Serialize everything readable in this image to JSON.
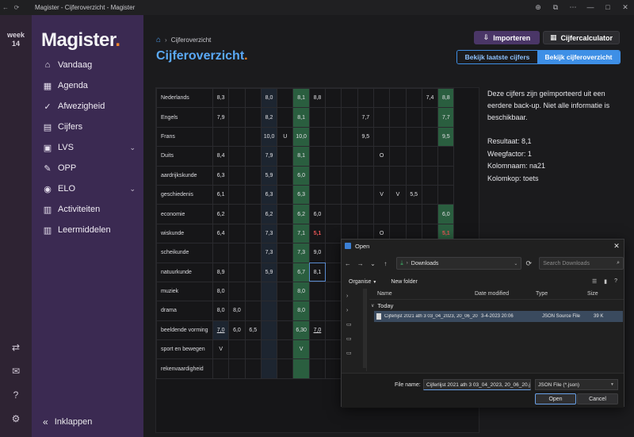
{
  "titlebar": {
    "title": "Magister - Cijferoverzicht - Magister",
    "back": "←",
    "reload": "⟳",
    "icons": [
      "⊕",
      "⧉",
      "⋯",
      "—",
      "□",
      "✕"
    ]
  },
  "weekbar": {
    "label": "week",
    "number": "14",
    "bottom_icons": [
      "⇄",
      "✉",
      "?",
      "⚙"
    ]
  },
  "sidebar": {
    "logo": "Magister",
    "logo_dot": ".",
    "items": [
      {
        "label": "Vandaag",
        "icon": "⌂"
      },
      {
        "label": "Agenda",
        "icon": "▦"
      },
      {
        "label": "Afwezigheid",
        "icon": "✓"
      },
      {
        "label": "Cijfers",
        "icon": "▤"
      },
      {
        "label": "LVS",
        "icon": "▣",
        "chevron": "⌄"
      },
      {
        "label": "OPP",
        "icon": "✎"
      },
      {
        "label": "ELO",
        "icon": "◉",
        "chevron": "⌄"
      },
      {
        "label": "Activiteiten",
        "icon": "▥"
      },
      {
        "label": "Leermiddelen",
        "icon": "▥"
      }
    ],
    "collapse": {
      "label": "Inklappen",
      "icon": "«"
    }
  },
  "header": {
    "breadcrumb": "Cijferoverzicht",
    "title": "Cijferoverzicht",
    "title_dot": ".",
    "import_button": "Importeren",
    "calc_button": "Cijfercalculator",
    "seg_latest": "Bekijk laatste cijfers",
    "seg_overview": "Bekijk cijferoverzicht"
  },
  "grades": {
    "rows": [
      {
        "subject": "Nederlands",
        "cells": [
          "8,3",
          "",
          "",
          "8,0",
          "",
          "8,1",
          "8,8",
          "",
          "",
          "",
          "",
          "",
          "",
          "7,4",
          "8,8"
        ]
      },
      {
        "subject": "Engels",
        "cells": [
          "7,9",
          "",
          "",
          "8,2",
          "",
          "8,1",
          "",
          "",
          "",
          "7,7",
          "",
          "",
          "",
          "",
          "7,7"
        ]
      },
      {
        "subject": "Frans",
        "cells": [
          "",
          "",
          "",
          "10,0",
          "U",
          "10,0",
          "",
          "",
          "",
          "9,5",
          "",
          "",
          "",
          "",
          "9,5"
        ]
      },
      {
        "subject": "Duits",
        "cells": [
          "8,4",
          "",
          "",
          "7,9",
          "",
          "8,1",
          "",
          "",
          "",
          "",
          "O",
          "",
          "",
          "",
          ""
        ]
      },
      {
        "subject": "aardrijkskunde",
        "cells": [
          "6,3",
          "",
          "",
          "5,9",
          "",
          "6,0",
          "",
          "",
          "",
          "",
          "",
          "",
          "",
          "",
          ""
        ]
      },
      {
        "subject": "geschiedenis",
        "cells": [
          "6,1",
          "",
          "",
          "6,3",
          "",
          "6,3",
          "",
          "",
          "",
          "",
          "V",
          "V",
          "5,5",
          "",
          ""
        ]
      },
      {
        "subject": "economie",
        "cells": [
          "6,2",
          "",
          "",
          "6,2",
          "",
          "6,2",
          "6,0",
          "",
          "",
          "",
          "",
          "",
          "",
          "",
          "6,0"
        ]
      },
      {
        "subject": "wiskunde",
        "cells": [
          "6,4",
          "",
          "",
          "7,3",
          "",
          "7,1",
          "5,1",
          "",
          "",
          "",
          "O",
          "",
          "",
          "",
          "5,1"
        ]
      },
      {
        "subject": "scheikunde",
        "cells": [
          "",
          "",
          "",
          "7,3",
          "",
          "7,3",
          "9,0",
          "",
          "",
          "",
          "",
          "",
          "",
          "",
          ""
        ]
      },
      {
        "subject": "natuurkunde",
        "cells": [
          "8,9",
          "",
          "",
          "5,9",
          "",
          "6,7",
          "8,1",
          "",
          "",
          "",
          "",
          "",
          "",
          "",
          ""
        ]
      },
      {
        "subject": "muziek",
        "cells": [
          "8,0",
          "",
          "",
          "",
          "",
          "8,0",
          "",
          "",
          "",
          "",
          "",
          "",
          "",
          "",
          ""
        ]
      },
      {
        "subject": "drama",
        "cells": [
          "8,0",
          "8,0",
          "",
          "",
          "",
          "8,0",
          "",
          "",
          "",
          "",
          "",
          "",
          "",
          "",
          ""
        ]
      },
      {
        "subject": "beeldende vorming",
        "cells": [
          "7,0",
          "6,0",
          "6,5",
          "",
          "",
          "6,30",
          "7,0",
          "",
          "",
          "",
          "",
          "",
          "",
          "",
          ""
        ]
      },
      {
        "subject": "sport en bewegen",
        "cells": [
          "V",
          "",
          "",
          "",
          "",
          "V",
          "",
          "",
          "",
          "",
          "",
          "",
          "",
          "",
          ""
        ]
      },
      {
        "subject": "rekenvaardigheid",
        "cells": [
          "",
          "",
          "",
          "",
          "",
          "",
          "",
          "",
          "",
          "",
          "",
          "",
          "",
          "",
          ""
        ]
      }
    ]
  },
  "info": {
    "message": "Deze cijfers zijn geïmporteerd uit een eerdere back-up. Niet alle informatie is beschikbaar.",
    "resultaat": "Resultaat: 8,1",
    "weegfactor": "Weegfactor: 1",
    "kolomnaam": "Kolomnaam: na21",
    "kolomkop": "Kolomkop: toets"
  },
  "dialog": {
    "title": "Open",
    "close": "✕",
    "nav": [
      "←",
      "→",
      "⌄",
      "↑"
    ],
    "path": "Downloads",
    "path_sep": "›",
    "refresh": "⟳",
    "search_placeholder": "Search Downloads",
    "search_icon": "⌕",
    "organise": "Organise",
    "new_folder": "New folder",
    "view_icons": [
      "☰",
      "▮",
      "?"
    ],
    "left_pane": [
      "›",
      "›",
      "▭",
      "▭",
      "▭"
    ],
    "columns": {
      "name": "Name",
      "date": "Date modified",
      "type": "Type",
      "size": "Size"
    },
    "group": "Today",
    "file": {
      "name": "Cijferlijst 2021 ath 3 03_04_2023, 20_06_20...",
      "date": "3-4-2023 20:06",
      "type": "JSON Source File",
      "size": "39 K"
    },
    "filename_label": "File name:",
    "filename_value": "Cijferlijst 2021 ath 3 03_04_2023, 20_06_20.jsc",
    "filetype": "JSON File (*.json)",
    "open": "Open",
    "cancel": "Cancel"
  }
}
